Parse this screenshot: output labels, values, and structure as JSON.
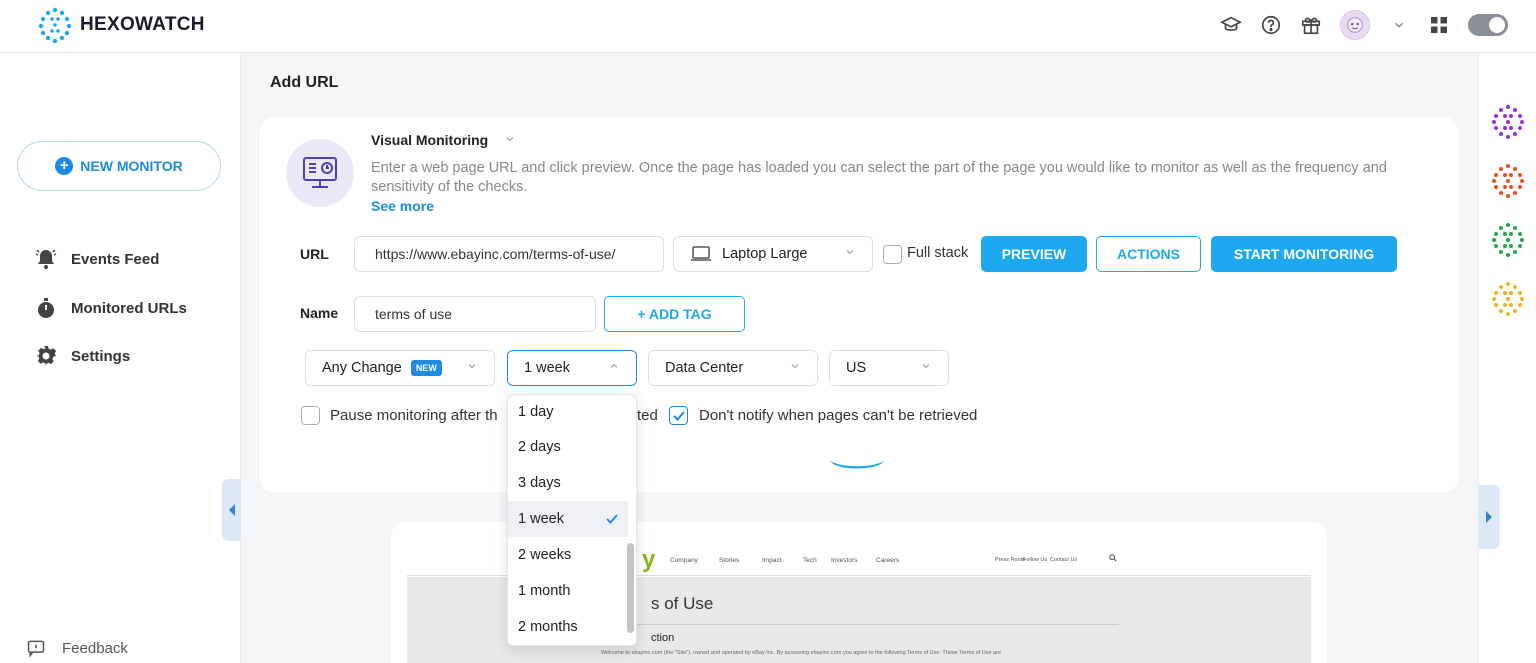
{
  "brand": {
    "name": "HEXOWATCH"
  },
  "topbar": {
    "icons": [
      "graduation-cap-icon",
      "help-circle-icon",
      "gift-icon",
      "avatar",
      "chevron-down-icon",
      "apps-grid-icon",
      "theme-toggle"
    ]
  },
  "sidebar": {
    "new_monitor": "NEW MONITOR",
    "items": [
      {
        "label": "Events Feed",
        "icon": "bell-icon"
      },
      {
        "label": "Monitored URLs",
        "icon": "stopwatch-icon"
      },
      {
        "label": "Settings",
        "icon": "gear-icon"
      }
    ],
    "feedback": "Feedback"
  },
  "main": {
    "title": "Add URL",
    "monitor": {
      "type": "Visual Monitoring",
      "description": "Enter a web page URL and click preview. Once the page has loaded you can select the part of the page you would like to monitor as well as the frequency and sensitivity of the checks.",
      "see_more": "See more"
    },
    "form": {
      "url_label": "URL",
      "url_value": "https://www.ebayinc.com/terms-of-use/",
      "device": "Laptop Large",
      "full_stack": "Full stack",
      "preview_btn": "PREVIEW",
      "actions_btn": "ACTIONS",
      "start_btn": "START MONITORING",
      "name_label": "Name",
      "name_value": "terms of use",
      "add_tag": "+ ADD TAG",
      "change_type": "Any Change",
      "new_badge": "NEW",
      "frequency": "1 week",
      "location_type": "Data Center",
      "region": "US",
      "pause_label_a": "Pause monitoring after th",
      "pause_label_b": "ted",
      "no_notify": "Don't notify when pages can't be retrieved"
    },
    "frequency_options": [
      "1 day",
      "2 days",
      "3 days",
      "1 week",
      "2 weeks",
      "1 month",
      "2 months"
    ],
    "selected_frequency": "1 week"
  },
  "preview": {
    "logo_fragment": "y",
    "nav": [
      "Company",
      "Stories",
      "Impact",
      "Tech",
      "Investors",
      "Careers"
    ],
    "nav_right": [
      "Press Room",
      "Follow Us",
      "Contact Us"
    ],
    "heading_fragment": "s of Use",
    "sub_fragment": "ction",
    "para": "Welcome to ebayinc.com (the \"Site\"), owned and operated by eBay Inc. By accessing ebayinc.com you agree to the following Terms of Use. These Terms of Use are"
  },
  "colors": {
    "accent": "#1ea8ef",
    "link": "#1c8be0",
    "rail": [
      "#9b2fd8",
      "#f04a1f",
      "#1fa84a",
      "#f0b41f"
    ]
  }
}
